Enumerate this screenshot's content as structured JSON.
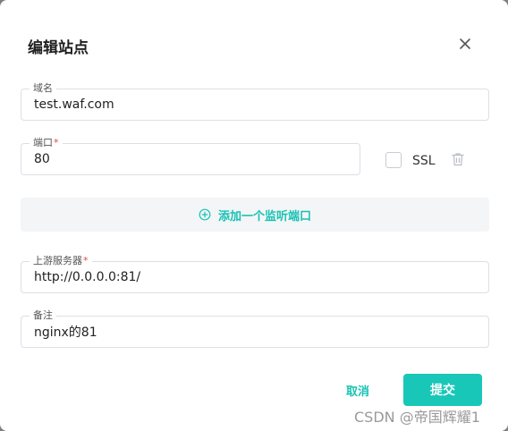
{
  "dialog": {
    "title": "编辑站点",
    "close_icon": "close-icon"
  },
  "form": {
    "domain": {
      "label": "域名",
      "value": "test.waf.com",
      "required": false
    },
    "port": {
      "label": "端口",
      "required_mark": "*",
      "value": "80"
    },
    "ssl": {
      "label": "SSL",
      "checked": false
    },
    "delete_icon": "trash-icon",
    "add_port": {
      "label": "添加一个监听端口",
      "icon": "plus-circle-icon"
    },
    "upstream": {
      "label": "上游服务器",
      "required_mark": "*",
      "value": "http://0.0.0.0:81/"
    },
    "remark": {
      "label": "备注",
      "value": "nginx的81"
    }
  },
  "actions": {
    "cancel_label": "取消",
    "submit_label": "提交"
  },
  "watermark": "CSDN @帝国辉耀1",
  "colors": {
    "accent": "#18c7b8",
    "required": "#e04848",
    "border": "#dcdfe6"
  }
}
